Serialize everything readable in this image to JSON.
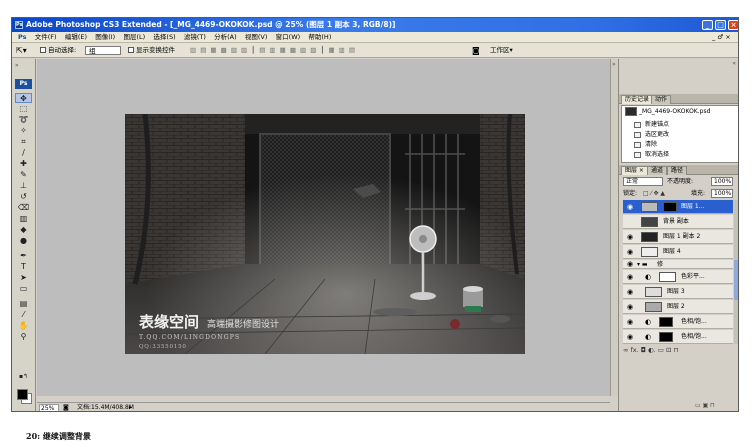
{
  "window": {
    "title": "Adobe Photoshop CS3 Extended - [_MG_4469-OKOKOK.psd @ 25% (图层 1 副本 3, RGB/8)]",
    "minimize": "_",
    "maximize": "□",
    "close": "×"
  },
  "menu": {
    "items": [
      "文件(F)",
      "编辑(E)",
      "图像(I)",
      "图层(L)",
      "选择(S)",
      "滤镜(T)",
      "分析(A)",
      "视图(V)",
      "窗口(W)",
      "帮助(H)"
    ],
    "doc_controls": "_ ♂ ×"
  },
  "options": {
    "auto_select_label": "自动选择:",
    "auto_select_value": "组",
    "show_transform_label": "显示变换控件",
    "workspace_label": "工作区▾"
  },
  "toolbox": {
    "ps_logo": "Ps",
    "tools": [
      "move",
      "marquee",
      "lasso",
      "magic-wand",
      "crop",
      "slice",
      "healing",
      "brush",
      "stamp",
      "history-brush",
      "eraser",
      "gradient",
      "blur",
      "dodge",
      "pen",
      "type",
      "path-select",
      "shape",
      "notes",
      "eyedropper",
      "hand",
      "zoom"
    ]
  },
  "canvas": {
    "brand": "表缘空间",
    "brand_sub": "高端摄影修图设计",
    "url": "T.QQ.COM/LINGDONGPS",
    "qq": "QQ:33550150"
  },
  "status": {
    "zoom": "25%",
    "doc_size": "文档:15.4M/408.8M"
  },
  "history_panel": {
    "tabs": [
      "历史记录 ×",
      "动作"
    ],
    "snapshot": "_MG_4469-OKOKOK.psd",
    "items": [
      "新建锚点",
      "选区更改",
      "清除",
      "取消选择"
    ]
  },
  "layers_panel": {
    "tabs": [
      "图层 ×",
      "通道",
      "路径"
    ],
    "blend_mode": "正常",
    "opacity_label": "不透明度:",
    "opacity_value": "100%",
    "lock_label": "锁定:",
    "fill_label": "填充:",
    "fill_value": "100%",
    "layers": [
      {
        "name": "图层 1...",
        "selected": true
      },
      {
        "name": "背景 副本",
        "selected": false
      },
      {
        "name": "图层 1 副本 2",
        "selected": false
      },
      {
        "name": "图层 4",
        "selected": false
      },
      {
        "name": "修",
        "selected": false
      },
      {
        "name": "色彩平...",
        "selected": false
      },
      {
        "name": "图层 3",
        "selected": false
      },
      {
        "name": "图层 2",
        "selected": false
      },
      {
        "name": "色相/饱...",
        "selected": false
      },
      {
        "name": "色相/饱...",
        "selected": false
      }
    ],
    "footer_icons": "∞ fx. ◘ ◐. ▭ ⊡ ⊓"
  },
  "caption": "20: 继续调整背景"
}
